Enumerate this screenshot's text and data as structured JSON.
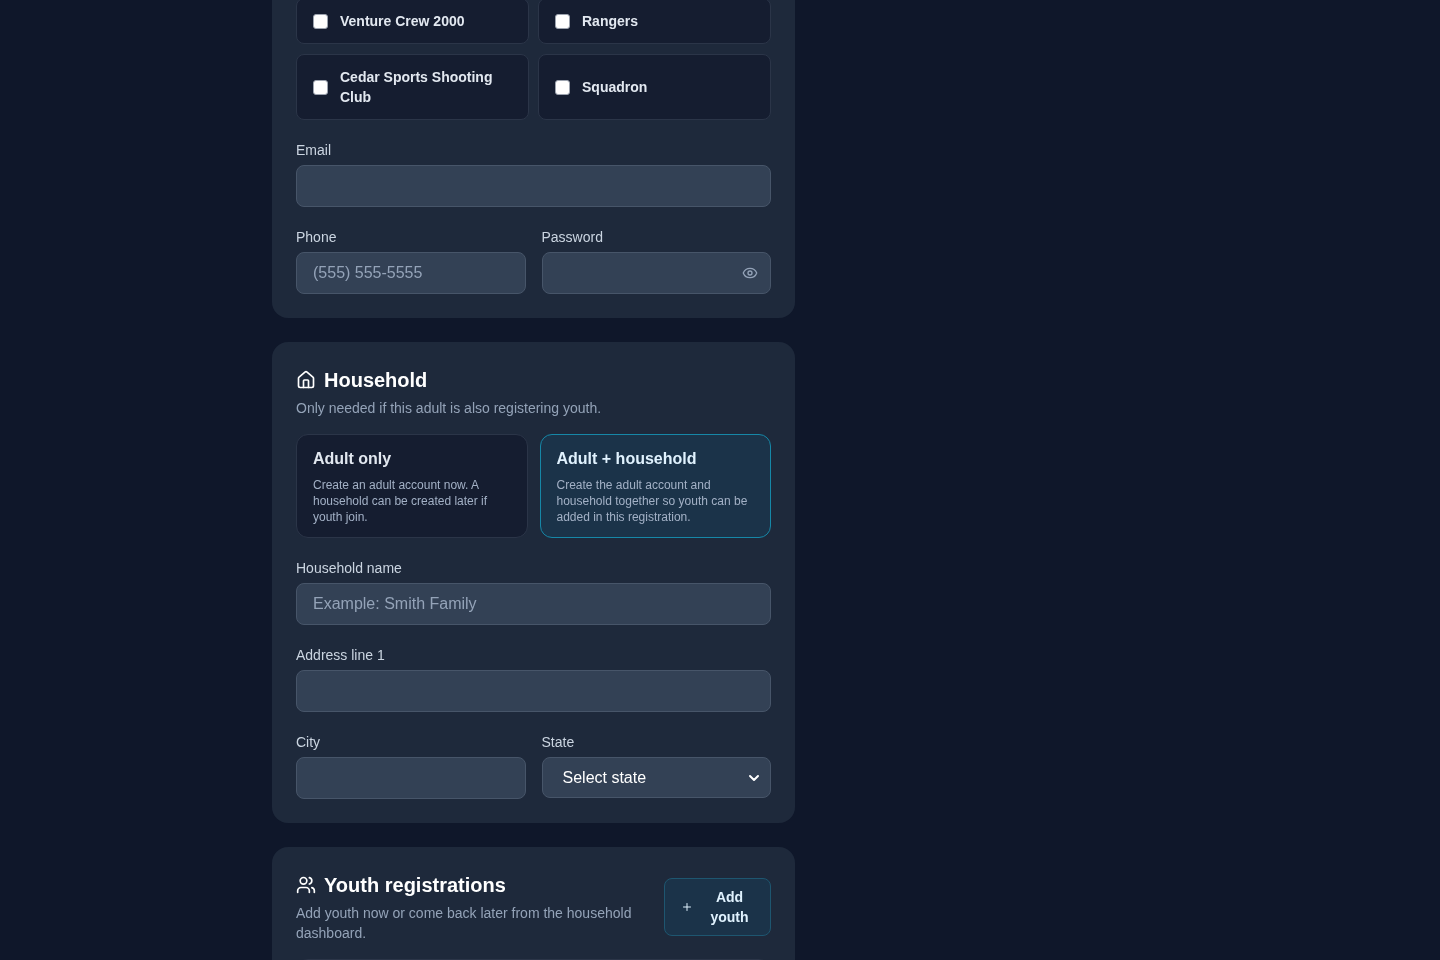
{
  "groups": [
    {
      "label": "Venture Crew 2000",
      "checked": false
    },
    {
      "label": "Rangers",
      "checked": false
    },
    {
      "label": "Cedar Sports Shooting Club",
      "checked": false
    },
    {
      "label": "Squadron",
      "checked": false
    }
  ],
  "account": {
    "email": {
      "label": "Email"
    },
    "phone": {
      "label": "Phone",
      "placeholder": "(555) 555-5555"
    },
    "password": {
      "label": "Password"
    }
  },
  "household": {
    "title": "Household",
    "subtitle": "Only needed if this adult is also registering youth.",
    "options": [
      {
        "title": "Adult only",
        "description": "Create an adult account now. A household can be created later if youth join.",
        "selected": false
      },
      {
        "title": "Adult + household",
        "description": "Create the adult account and household together so youth can be added in this registration.",
        "selected": true
      }
    ],
    "name_field": {
      "label": "Household name",
      "placeholder": "Example: Smith Family"
    },
    "address": {
      "label": "Address line 1"
    },
    "city": {
      "label": "City"
    },
    "state": {
      "label": "State",
      "value": "Select state"
    }
  },
  "youth": {
    "title": "Youth registrations",
    "subtitle": "Add youth now or come back later from the household dashboard.",
    "add_button": "Add youth"
  }
}
